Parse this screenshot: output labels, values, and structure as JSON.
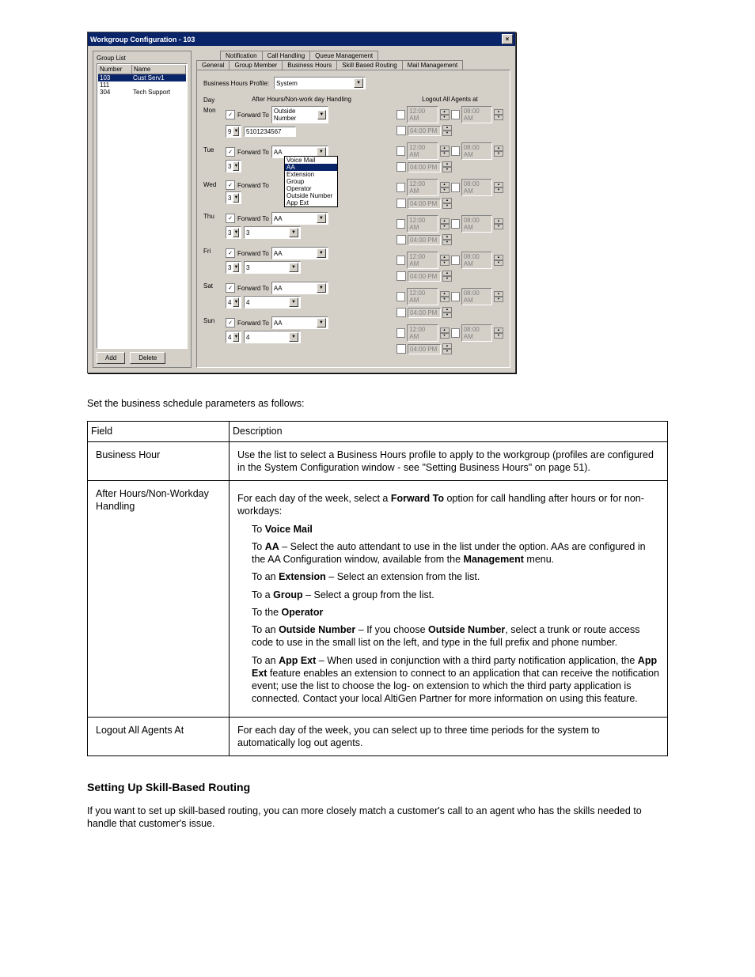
{
  "dialog": {
    "title": "Workgroup Configuration - 103",
    "group_list_label": "Group List",
    "cols": {
      "number": "Number",
      "name": "Name"
    },
    "rows": [
      {
        "num": "103",
        "name": "Cust Serv1",
        "selected": true
      },
      {
        "num": "111",
        "name": ""
      },
      {
        "num": "304",
        "name": "Tech Support"
      }
    ],
    "add_btn": "Add",
    "delete_btn": "Delete",
    "tabs_top": [
      "Notification",
      "Call Handling",
      "Queue Management"
    ],
    "tabs_bot": [
      "General",
      "Group Member",
      "Business Hours",
      "Skill Based Routing",
      "Mail Management"
    ],
    "bhp_label": "Business Hours Profile:",
    "bhp_value": "System",
    "left_header": "After Hours/Non-work day Handling",
    "right_header": "Logout All Agents at",
    "day_header": "Day",
    "forward_to": "Forward To",
    "days": [
      "Mon",
      "Tue",
      "Wed",
      "Thu",
      "Fri",
      "Sat",
      "Sun"
    ],
    "mon_target": "Outside Number",
    "mon_num_prefix": "9",
    "mon_num": "5101234567",
    "aa_val": "AA",
    "sub_vals": {
      "three": "3",
      "four": "4"
    },
    "dd_open": [
      "Voice Mail",
      "AA",
      "Extension",
      "Group",
      "Operator",
      "Outside Number",
      "App Ext"
    ],
    "time1": "12:00 AM",
    "time2": "08:00 AM",
    "time3": "04:00 PM"
  },
  "body": {
    "intro": "Set the business schedule parameters as follows:",
    "th_field": "Field",
    "th_desc": "Description",
    "r1_field": "Business Hour",
    "r1_desc": "Use the list to select a Business Hours profile to apply to the workgroup (profiles are configured in the System Configuration window - see \"Setting Business Hours\" on page 51).",
    "r2_field": "After Hours/Non-Workday Handling",
    "r2_intro_a": "For each day of the week, select a ",
    "r2_intro_b": "Forward To",
    "r2_intro_c": " option for call handling after hours or for non-workdays:",
    "r2_vm_a": "To ",
    "r2_vm_b": "Voice Mail",
    "r2_aa_a": "To ",
    "r2_aa_b": "AA",
    "r2_aa_c": " – Select the auto attendant to use in the list under the option. AAs are configured in the AA Configuration window, available from the ",
    "r2_aa_d": "Management",
    "r2_aa_e": " menu.",
    "r2_ext_a": "To an ",
    "r2_ext_b": "Extension",
    "r2_ext_c": " – Select an extension from the list.",
    "r2_grp_a": "To a ",
    "r2_grp_b": "Group",
    "r2_grp_c": " – Select a group from the list.",
    "r2_op_a": "To the ",
    "r2_op_b": "Operator",
    "r2_out_a": "To an ",
    "r2_out_b": "Outside Number",
    "r2_out_c": " – If you choose ",
    "r2_out_d": "Outside Number",
    "r2_out_e": ", select a trunk or route access code to use in the small list on the left, and type in the full prefix and phone number.",
    "r2_app_a": "To an ",
    "r2_app_b": "App Ext",
    "r2_app_c": " – When used in conjunction with a third party notification application, the ",
    "r2_app_d": "App Ext",
    "r2_app_e": " feature enables an extension to connect to an application that can receive the notification event; use the list to choose the log- on extension to which the third party application is connected. Contact your local AltiGen Partner for more information on using this feature.",
    "r3_field": "Logout All Agents At",
    "r3_desc": "For each day of the week, you can select up to three time periods for the system to automatically log out agents.",
    "section": "Setting Up Skill-Based Routing",
    "tail": "If you want to set up skill-based routing, you can more closely match a customer's call to an agent who has the skills needed to handle that customer's issue."
  }
}
